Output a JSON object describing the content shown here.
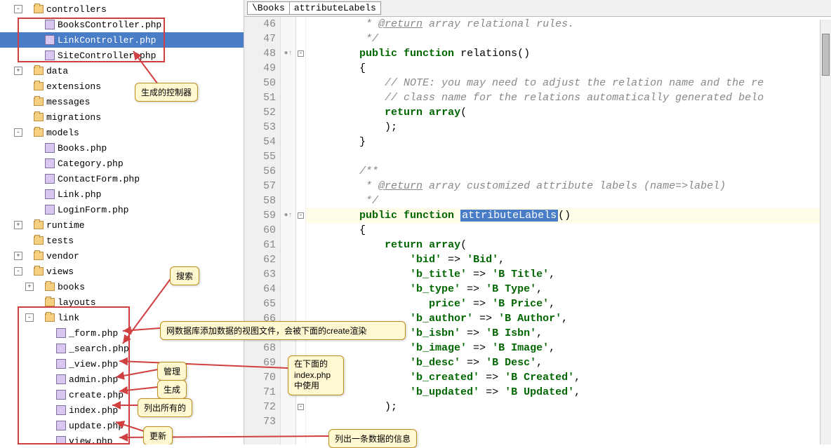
{
  "breadcrumb": {
    "part1": "\\Books",
    "part2": "attributeLabels"
  },
  "tree": {
    "nodes": [
      {
        "indent": 1,
        "toggle": "-",
        "icon": "folder",
        "label": "controllers"
      },
      {
        "indent": 2,
        "toggle": "",
        "icon": "php",
        "label": "BooksController.php"
      },
      {
        "indent": 2,
        "toggle": "",
        "icon": "php",
        "label": "LinkController.php",
        "selected": true
      },
      {
        "indent": 2,
        "toggle": "",
        "icon": "php",
        "label": "SiteController.php"
      },
      {
        "indent": 1,
        "toggle": "+",
        "icon": "folder",
        "label": "data"
      },
      {
        "indent": 1,
        "toggle": "",
        "icon": "folder",
        "label": "extensions"
      },
      {
        "indent": 1,
        "toggle": "",
        "icon": "folder",
        "label": "messages"
      },
      {
        "indent": 1,
        "toggle": "",
        "icon": "folder",
        "label": "migrations"
      },
      {
        "indent": 1,
        "toggle": "-",
        "icon": "folder",
        "label": "models"
      },
      {
        "indent": 2,
        "toggle": "",
        "icon": "php",
        "label": "Books.php"
      },
      {
        "indent": 2,
        "toggle": "",
        "icon": "php",
        "label": "Category.php"
      },
      {
        "indent": 2,
        "toggle": "",
        "icon": "php",
        "label": "ContactForm.php"
      },
      {
        "indent": 2,
        "toggle": "",
        "icon": "php",
        "label": "Link.php"
      },
      {
        "indent": 2,
        "toggle": "",
        "icon": "php",
        "label": "LoginForm.php"
      },
      {
        "indent": 1,
        "toggle": "+",
        "icon": "folder",
        "label": "runtime"
      },
      {
        "indent": 1,
        "toggle": "",
        "icon": "folder",
        "label": "tests"
      },
      {
        "indent": 1,
        "toggle": "+",
        "icon": "folder",
        "label": "vendor"
      },
      {
        "indent": 1,
        "toggle": "-",
        "icon": "folder",
        "label": "views"
      },
      {
        "indent": 2,
        "toggle": "+",
        "icon": "folder",
        "label": "books"
      },
      {
        "indent": 2,
        "toggle": "",
        "icon": "folder",
        "label": "layouts"
      },
      {
        "indent": 2,
        "toggle": "-",
        "icon": "folder",
        "label": "link"
      },
      {
        "indent": 3,
        "toggle": "",
        "icon": "php",
        "label": "_form.php"
      },
      {
        "indent": 3,
        "toggle": "",
        "icon": "php",
        "label": "_search.php"
      },
      {
        "indent": 3,
        "toggle": "",
        "icon": "php",
        "label": "_view.php"
      },
      {
        "indent": 3,
        "toggle": "",
        "icon": "php",
        "label": "admin.php"
      },
      {
        "indent": 3,
        "toggle": "",
        "icon": "php",
        "label": "create.php"
      },
      {
        "indent": 3,
        "toggle": "",
        "icon": "php",
        "label": "index.php"
      },
      {
        "indent": 3,
        "toggle": "",
        "icon": "php",
        "label": "update.php"
      },
      {
        "indent": 3,
        "toggle": "",
        "icon": "php",
        "label": "view.php"
      }
    ]
  },
  "annotations": {
    "a1": "生成的控制器",
    "a2": "搜索",
    "a3": "网数据库添加数据的视图文件，会被下面的create渲染",
    "a4": "管理",
    "a5": "生成",
    "a6": "列出所有的",
    "a7": "更新",
    "a8": "在下面的index.php中使用",
    "a9": "列出一条数据的信息"
  },
  "code": {
    "first_line": 46,
    "highlight_line": 59,
    "lines": [
      {
        "n": 46,
        "html": "         <span class='comment'>* <span class='doc-tag'>@return</span> array relational rules.</span>"
      },
      {
        "n": 47,
        "html": "         <span class='comment'>*/</span>"
      },
      {
        "n": 48,
        "html": "        <span class='kw'>public</span> <span class='kw'>function</span> relations()",
        "fold": "-",
        "mark": "●↑"
      },
      {
        "n": 49,
        "html": "        {"
      },
      {
        "n": 50,
        "html": "            <span class='comment'>// NOTE: you may need to adjust the relation name and the re</span>"
      },
      {
        "n": 51,
        "html": "            <span class='comment'>// class name for the relations automatically generated belo</span>"
      },
      {
        "n": 52,
        "html": "            <span class='kw'>return</span> <span class='kw'>array</span>("
      },
      {
        "n": 53,
        "html": "            );"
      },
      {
        "n": 54,
        "html": "        }"
      },
      {
        "n": 55,
        "html": ""
      },
      {
        "n": 56,
        "html": "        <span class='comment'>/**</span>"
      },
      {
        "n": 57,
        "html": "         <span class='comment'>* <span class='doc-tag'>@return</span> array customized attribute labels (name=>label)</span>"
      },
      {
        "n": 58,
        "html": "         <span class='comment'>*/</span>"
      },
      {
        "n": 59,
        "html": "        <span class='kw'>public</span> <span class='kw'>function</span> <span class='hl-box'>attributeLabels</span>()",
        "fold": "-",
        "mark": "●↑"
      },
      {
        "n": 60,
        "html": "        {"
      },
      {
        "n": 61,
        "html": "            <span class='kw'>return</span> <span class='kw'>array</span>("
      },
      {
        "n": 62,
        "html": "                <span class='str'>'bid'</span> => <span class='str'>'Bid'</span>,"
      },
      {
        "n": 63,
        "html": "                <span class='str'>'b_title'</span> => <span class='str'>'B Title'</span>,"
      },
      {
        "n": 64,
        "html": "                <span class='str'>'b_type'</span> => <span class='str'>'B Type'</span>,"
      },
      {
        "n": 65,
        "html": "                   <span class='str'>price'</span> => <span class='str'>'B Price'</span>,"
      },
      {
        "n": 66,
        "html": "                <span class='str'>'b_author'</span> => <span class='str'>'B Author'</span>,"
      },
      {
        "n": 67,
        "html": "                <span class='str'>'b_isbn'</span> => <span class='str'>'B Isbn'</span>,"
      },
      {
        "n": 68,
        "html": "                <span class='str'>'b_image'</span> => <span class='str'>'B Image'</span>,"
      },
      {
        "n": 69,
        "html": "                <span class='str'>'b_desc'</span> => <span class='str'>'B Desc'</span>,"
      },
      {
        "n": 70,
        "html": "                <span class='str'>'b_created'</span> => <span class='str'>'B Created'</span>,"
      },
      {
        "n": 71,
        "html": "                <span class='str'>'b_updated'</span> => <span class='str'>'B Updated'</span>,"
      },
      {
        "n": 72,
        "html": "            );",
        "fold": "-"
      },
      {
        "n": 73,
        "html": ""
      }
    ]
  }
}
